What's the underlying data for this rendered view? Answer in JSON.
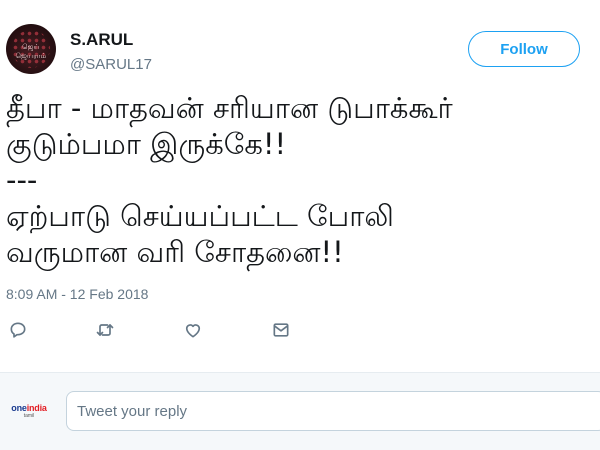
{
  "user": {
    "display_name": "S.ARUL",
    "handle": "@SARUL17",
    "avatar_text": "ஜெய் ஜெயராம்"
  },
  "follow_button": {
    "label": "Follow"
  },
  "tweet": {
    "lines": [
      "தீபா - மாதவன் சரியான டுபாக்கூர்",
      "குடும்பமா இருக்கே!!",
      "---",
      "ஏற்பாடு  செய்யப்பட்ட போலி",
      "வருமான வரி சோதனை!!"
    ],
    "timestamp": "8:09 AM - 12 Feb 2018"
  },
  "actions": [
    {
      "icon": "reply-icon"
    },
    {
      "icon": "retweet-icon"
    },
    {
      "icon": "like-icon"
    },
    {
      "icon": "direct-message-icon"
    }
  ],
  "reply_box": {
    "placeholder": "Tweet your reply",
    "logo_main_a": "one",
    "logo_main_b": "india",
    "logo_sub": "tamil"
  },
  "colors": {
    "accent": "#1da1f2",
    "text": "#14171a",
    "secondary_text": "#657786",
    "icon": "#657786"
  }
}
